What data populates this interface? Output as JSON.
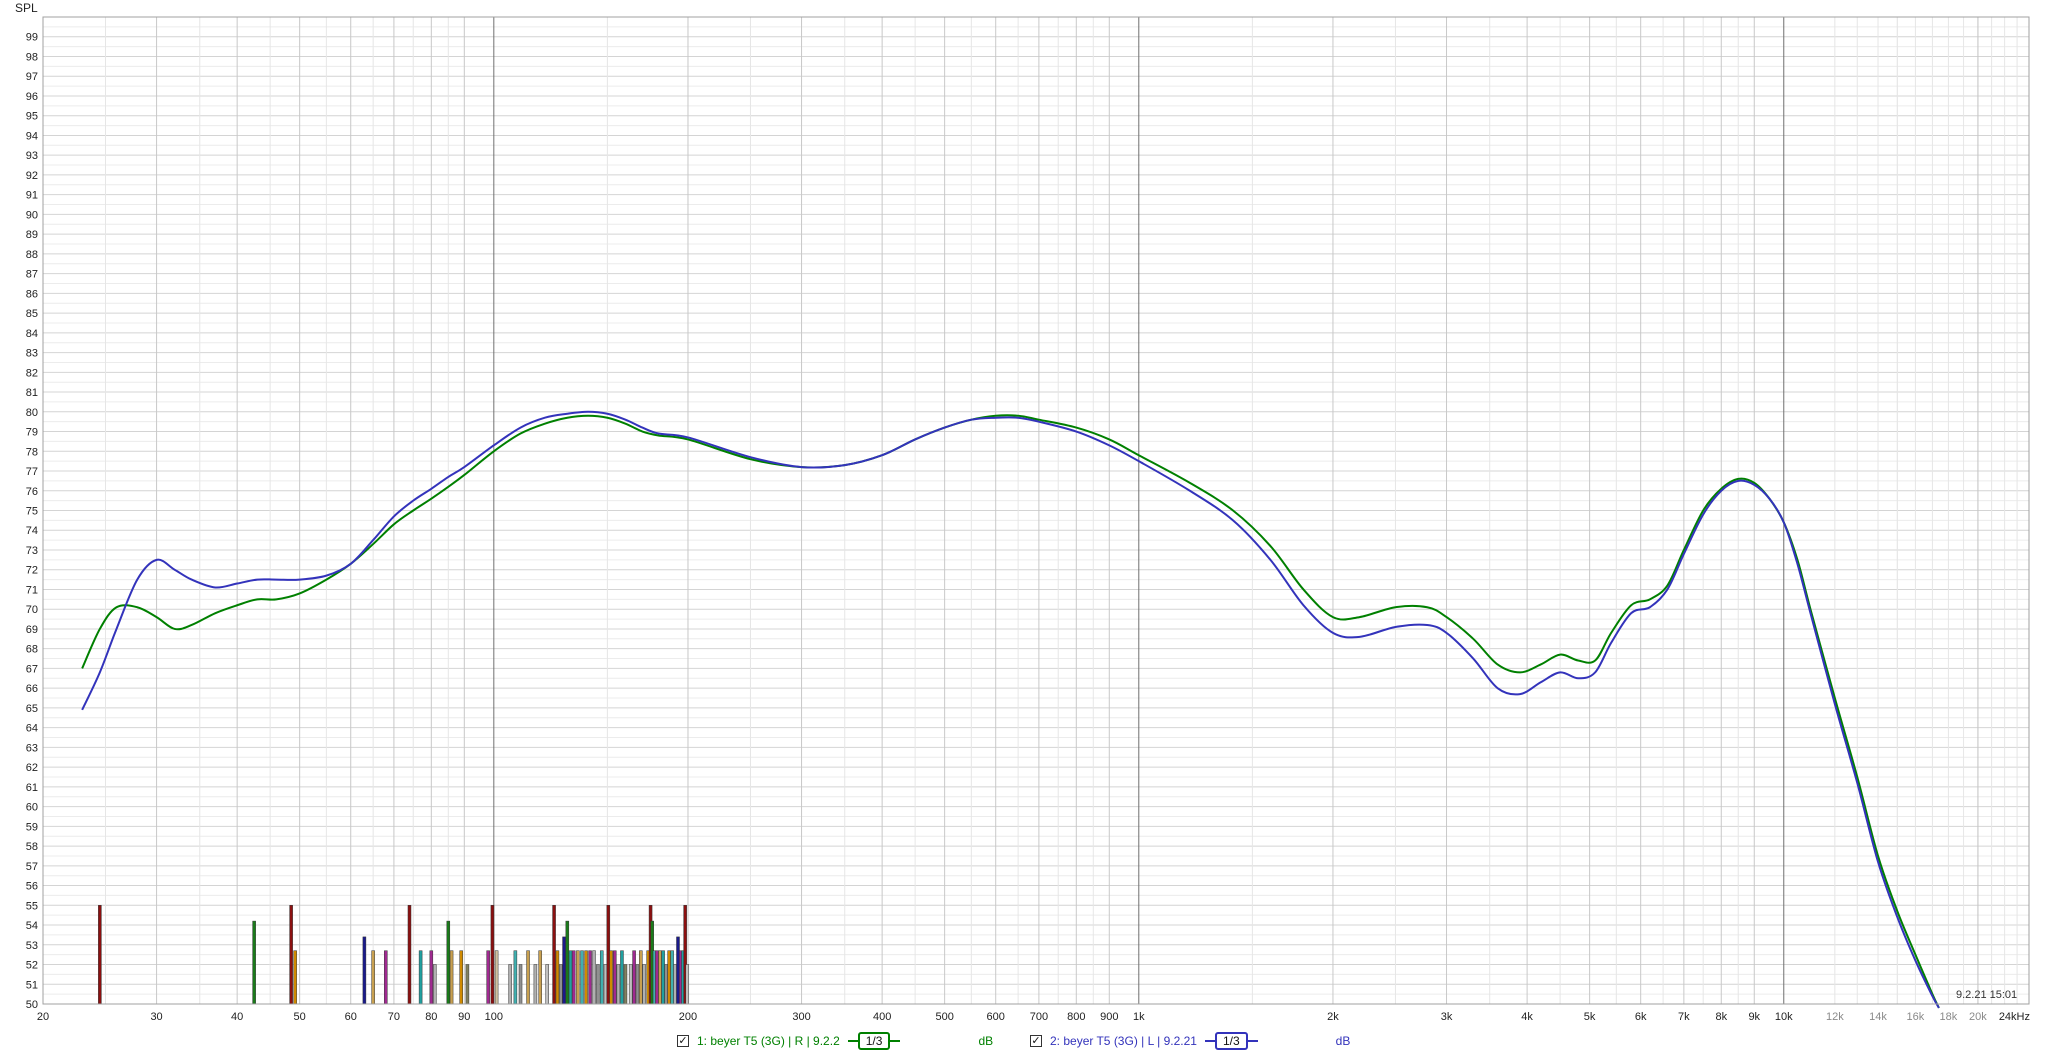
{
  "chart_data": {
    "type": "line",
    "title": "",
    "ylabel": "SPL",
    "xlabel": "",
    "x_scale": "log",
    "xlim": [
      20,
      24000
    ],
    "ylim": [
      50,
      100
    ],
    "grid": true,
    "timestamp": "9.2.21 15:01",
    "x_ticks": [
      {
        "v": 20,
        "label": "20"
      },
      {
        "v": 30,
        "label": "30"
      },
      {
        "v": 40,
        "label": "40"
      },
      {
        "v": 50,
        "label": "50"
      },
      {
        "v": 60,
        "label": "60"
      },
      {
        "v": 70,
        "label": "70"
      },
      {
        "v": 80,
        "label": "80"
      },
      {
        "v": 90,
        "label": "90"
      },
      {
        "v": 100,
        "label": "100"
      },
      {
        "v": 200,
        "label": "200"
      },
      {
        "v": 300,
        "label": "300"
      },
      {
        "v": 400,
        "label": "400"
      },
      {
        "v": 500,
        "label": "500"
      },
      {
        "v": 600,
        "label": "600"
      },
      {
        "v": 700,
        "label": "700"
      },
      {
        "v": 800,
        "label": "800"
      },
      {
        "v": 900,
        "label": "900"
      },
      {
        "v": 1000,
        "label": "1k"
      },
      {
        "v": 2000,
        "label": "2k"
      },
      {
        "v": 3000,
        "label": "3k"
      },
      {
        "v": 4000,
        "label": "4k"
      },
      {
        "v": 5000,
        "label": "5k"
      },
      {
        "v": 6000,
        "label": "6k"
      },
      {
        "v": 7000,
        "label": "7k"
      },
      {
        "v": 8000,
        "label": "8k"
      },
      {
        "v": 9000,
        "label": "9k"
      },
      {
        "v": 10000,
        "label": "10k"
      },
      {
        "v": 12000,
        "label": "12k"
      },
      {
        "v": 14000,
        "label": "14k"
      },
      {
        "v": 16000,
        "label": "16k"
      },
      {
        "v": 18000,
        "label": "18k"
      },
      {
        "v": 20000,
        "label": "20k"
      },
      {
        "v": 24000,
        "label": "24kHz"
      }
    ],
    "series": [
      {
        "name": "1: beyer T5 (3G) | R | 9.2.2",
        "color": "#008000",
        "points": [
          [
            23,
            67.0
          ],
          [
            24.5,
            69.0
          ],
          [
            26,
            70.1
          ],
          [
            28,
            70.1
          ],
          [
            30,
            69.6
          ],
          [
            32,
            69.0
          ],
          [
            34,
            69.2
          ],
          [
            37,
            69.8
          ],
          [
            40,
            70.2
          ],
          [
            43,
            70.5
          ],
          [
            46,
            70.5
          ],
          [
            50,
            70.8
          ],
          [
            55,
            71.5
          ],
          [
            60,
            72.3
          ],
          [
            65,
            73.3
          ],
          [
            70,
            74.3
          ],
          [
            75,
            75.0
          ],
          [
            80,
            75.6
          ],
          [
            85,
            76.2
          ],
          [
            90,
            76.8
          ],
          [
            100,
            78.0
          ],
          [
            110,
            78.9
          ],
          [
            120,
            79.4
          ],
          [
            130,
            79.7
          ],
          [
            140,
            79.8
          ],
          [
            150,
            79.7
          ],
          [
            160,
            79.4
          ],
          [
            170,
            79.0
          ],
          [
            180,
            78.8
          ],
          [
            200,
            78.6
          ],
          [
            250,
            77.6
          ],
          [
            300,
            77.2
          ],
          [
            350,
            77.3
          ],
          [
            400,
            77.8
          ],
          [
            450,
            78.6
          ],
          [
            500,
            79.2
          ],
          [
            550,
            79.6
          ],
          [
            600,
            79.8
          ],
          [
            650,
            79.8
          ],
          [
            700,
            79.6
          ],
          [
            800,
            79.2
          ],
          [
            900,
            78.6
          ],
          [
            1000,
            77.8
          ],
          [
            1200,
            76.4
          ],
          [
            1400,
            75.0
          ],
          [
            1600,
            73.2
          ],
          [
            1800,
            71.0
          ],
          [
            2000,
            69.6
          ],
          [
            2200,
            69.6
          ],
          [
            2500,
            70.1
          ],
          [
            2800,
            70.1
          ],
          [
            3000,
            69.6
          ],
          [
            3300,
            68.5
          ],
          [
            3600,
            67.2
          ],
          [
            3900,
            66.8
          ],
          [
            4200,
            67.2
          ],
          [
            4500,
            67.7
          ],
          [
            4800,
            67.4
          ],
          [
            5100,
            67.4
          ],
          [
            5400,
            68.8
          ],
          [
            5800,
            70.2
          ],
          [
            6200,
            70.5
          ],
          [
            6600,
            71.2
          ],
          [
            7000,
            73.0
          ],
          [
            7500,
            75.0
          ],
          [
            8000,
            76.1
          ],
          [
            8500,
            76.6
          ],
          [
            9000,
            76.4
          ],
          [
            9500,
            75.6
          ],
          [
            10000,
            74.4
          ],
          [
            10500,
            72.5
          ],
          [
            11000,
            70.0
          ],
          [
            12000,
            65.5
          ],
          [
            13000,
            61.5
          ],
          [
            14000,
            57.5
          ],
          [
            15000,
            54.7
          ],
          [
            16000,
            52.5
          ],
          [
            17000,
            50.5
          ],
          [
            17400,
            49.8
          ]
        ]
      },
      {
        "name": "2: beyer T5 (3G) | L | 9.2.21",
        "color": "#3333bb",
        "points": [
          [
            23,
            64.9
          ],
          [
            24.5,
            66.8
          ],
          [
            26,
            69.0
          ],
          [
            28,
            71.5
          ],
          [
            30,
            72.5
          ],
          [
            32,
            72.0
          ],
          [
            34,
            71.5
          ],
          [
            37,
            71.1
          ],
          [
            40,
            71.3
          ],
          [
            43,
            71.5
          ],
          [
            46,
            71.5
          ],
          [
            50,
            71.5
          ],
          [
            55,
            71.7
          ],
          [
            60,
            72.3
          ],
          [
            65,
            73.5
          ],
          [
            70,
            74.7
          ],
          [
            75,
            75.5
          ],
          [
            80,
            76.1
          ],
          [
            85,
            76.7
          ],
          [
            90,
            77.2
          ],
          [
            100,
            78.3
          ],
          [
            110,
            79.2
          ],
          [
            120,
            79.7
          ],
          [
            130,
            79.9
          ],
          [
            140,
            80.0
          ],
          [
            150,
            79.9
          ],
          [
            160,
            79.6
          ],
          [
            170,
            79.2
          ],
          [
            180,
            78.9
          ],
          [
            200,
            78.7
          ],
          [
            250,
            77.7
          ],
          [
            300,
            77.2
          ],
          [
            350,
            77.3
          ],
          [
            400,
            77.8
          ],
          [
            450,
            78.6
          ],
          [
            500,
            79.2
          ],
          [
            550,
            79.6
          ],
          [
            600,
            79.7
          ],
          [
            650,
            79.7
          ],
          [
            700,
            79.5
          ],
          [
            800,
            79.0
          ],
          [
            900,
            78.3
          ],
          [
            1000,
            77.5
          ],
          [
            1200,
            76.0
          ],
          [
            1400,
            74.5
          ],
          [
            1600,
            72.5
          ],
          [
            1800,
            70.2
          ],
          [
            2000,
            68.8
          ],
          [
            2200,
            68.6
          ],
          [
            2500,
            69.1
          ],
          [
            2800,
            69.2
          ],
          [
            3000,
            68.8
          ],
          [
            3300,
            67.5
          ],
          [
            3600,
            66.0
          ],
          [
            3900,
            65.7
          ],
          [
            4200,
            66.3
          ],
          [
            4500,
            66.8
          ],
          [
            4800,
            66.5
          ],
          [
            5100,
            66.8
          ],
          [
            5400,
            68.3
          ],
          [
            5800,
            69.8
          ],
          [
            6200,
            70.1
          ],
          [
            6600,
            71.0
          ],
          [
            7000,
            72.8
          ],
          [
            7500,
            74.8
          ],
          [
            8000,
            76.0
          ],
          [
            8500,
            76.5
          ],
          [
            9000,
            76.3
          ],
          [
            9500,
            75.6
          ],
          [
            10000,
            74.4
          ],
          [
            10500,
            72.3
          ],
          [
            11000,
            69.8
          ],
          [
            12000,
            65.2
          ],
          [
            13000,
            61.2
          ],
          [
            14000,
            57.2
          ],
          [
            15000,
            54.4
          ],
          [
            16000,
            52.2
          ],
          [
            17000,
            50.4
          ],
          [
            17400,
            49.8
          ]
        ]
      }
    ],
    "distortion_bars": [
      {
        "x": 24.5,
        "y": 55.0,
        "color": "#8b1010"
      },
      {
        "x": 42.5,
        "y": 54.2,
        "color": "#1a7a1a"
      },
      {
        "x": 48.5,
        "y": 55.0,
        "color": "#8b1010"
      },
      {
        "x": 49.2,
        "y": 52.7,
        "color": "#d08a00"
      },
      {
        "x": 63,
        "y": 53.4,
        "color": "#1a1a8b"
      },
      {
        "x": 65,
        "y": 52.7,
        "color": "#c8a050"
      },
      {
        "x": 68,
        "y": 52.7,
        "color": "#a02a90"
      },
      {
        "x": 74,
        "y": 55.0,
        "color": "#8b1010"
      },
      {
        "x": 77,
        "y": 52.7,
        "color": "#20a0a0"
      },
      {
        "x": 80,
        "y": 52.7,
        "color": "#a02a90"
      },
      {
        "x": 81,
        "y": 52.0,
        "color": "#b0b0b0"
      },
      {
        "x": 85,
        "y": 54.2,
        "color": "#1a7a1a"
      },
      {
        "x": 86,
        "y": 52.7,
        "color": "#c8a050"
      },
      {
        "x": 89,
        "y": 52.7,
        "color": "#d08a00"
      },
      {
        "x": 91,
        "y": 52.0,
        "color": "#808060"
      },
      {
        "x": 98,
        "y": 52.7,
        "color": "#a02a90"
      },
      {
        "x": 99.5,
        "y": 55.0,
        "color": "#8b1010"
      },
      {
        "x": 101,
        "y": 52.7,
        "color": "#d0c0a0"
      },
      {
        "x": 106,
        "y": 52.0,
        "color": "#b0b0b0"
      },
      {
        "x": 108,
        "y": 52.7,
        "color": "#40b0b0"
      },
      {
        "x": 110,
        "y": 52.0,
        "color": "#909090"
      },
      {
        "x": 113,
        "y": 52.7,
        "color": "#c8a050"
      },
      {
        "x": 116,
        "y": 52.0,
        "color": "#b0b0b0"
      },
      {
        "x": 118,
        "y": 52.7,
        "color": "#c8a050"
      },
      {
        "x": 121,
        "y": 52.0,
        "color": "#c0c0c0"
      },
      {
        "x": 124,
        "y": 55.0,
        "color": "#8b1010"
      },
      {
        "x": 125.5,
        "y": 52.7,
        "color": "#d08a00"
      },
      {
        "x": 127,
        "y": 52.0,
        "color": "#909090"
      },
      {
        "x": 128.5,
        "y": 53.4,
        "color": "#1a1a8b"
      },
      {
        "x": 130,
        "y": 54.2,
        "color": "#1a7a1a"
      },
      {
        "x": 131.5,
        "y": 52.7,
        "color": "#20a0a0"
      },
      {
        "x": 133,
        "y": 52.7,
        "color": "#a02a90"
      },
      {
        "x": 135,
        "y": 52.7,
        "color": "#c8a050"
      },
      {
        "x": 137,
        "y": 52.7,
        "color": "#40b0b0"
      },
      {
        "x": 139,
        "y": 52.7,
        "color": "#d08a00"
      },
      {
        "x": 141,
        "y": 52.7,
        "color": "#a02a90"
      },
      {
        "x": 143,
        "y": 52.7,
        "color": "#b0b0b0"
      },
      {
        "x": 145,
        "y": 52.0,
        "color": "#909090"
      },
      {
        "x": 147,
        "y": 52.7,
        "color": "#40b0b0"
      },
      {
        "x": 149,
        "y": 52.0,
        "color": "#c0c0c0"
      },
      {
        "x": 150.5,
        "y": 55.0,
        "color": "#8b1010"
      },
      {
        "x": 152,
        "y": 52.7,
        "color": "#d08a00"
      },
      {
        "x": 154,
        "y": 52.7,
        "color": "#a02a90"
      },
      {
        "x": 156,
        "y": 52.0,
        "color": "#b0b0b0"
      },
      {
        "x": 158,
        "y": 52.7,
        "color": "#20a0a0"
      },
      {
        "x": 160,
        "y": 52.0,
        "color": "#808060"
      },
      {
        "x": 163,
        "y": 52.0,
        "color": "#c0c0c0"
      },
      {
        "x": 165,
        "y": 52.7,
        "color": "#a02a90"
      },
      {
        "x": 167,
        "y": 52.0,
        "color": "#909090"
      },
      {
        "x": 169,
        "y": 52.7,
        "color": "#c8a050"
      },
      {
        "x": 171,
        "y": 52.0,
        "color": "#b0b0b0"
      },
      {
        "x": 173.5,
        "y": 52.7,
        "color": "#d08a00"
      },
      {
        "x": 175,
        "y": 55.0,
        "color": "#8b1010"
      },
      {
        "x": 176,
        "y": 54.2,
        "color": "#1a7a1a"
      },
      {
        "x": 177.5,
        "y": 52.7,
        "color": "#40b0b0"
      },
      {
        "x": 179,
        "y": 52.7,
        "color": "#a02a90"
      },
      {
        "x": 181,
        "y": 52.7,
        "color": "#c8a050"
      },
      {
        "x": 183,
        "y": 52.7,
        "color": "#20a0a0"
      },
      {
        "x": 185,
        "y": 52.0,
        "color": "#909090"
      },
      {
        "x": 187,
        "y": 52.7,
        "color": "#d08a00"
      },
      {
        "x": 189,
        "y": 52.7,
        "color": "#40b0b0"
      },
      {
        "x": 191,
        "y": 52.0,
        "color": "#b0b0b0"
      },
      {
        "x": 193,
        "y": 53.4,
        "color": "#1a1a8b"
      },
      {
        "x": 195,
        "y": 52.7,
        "color": "#a02a90"
      },
      {
        "x": 196.5,
        "y": 52.7,
        "color": "#20a0a0"
      },
      {
        "x": 198,
        "y": 55.0,
        "color": "#8b1010"
      },
      {
        "x": 199.5,
        "y": 52.0,
        "color": "#c0c0c0"
      }
    ]
  },
  "legend": {
    "items": [
      {
        "label": "1: beyer T5 (3G) | R | 9.2.2",
        "smoothing": "1/3",
        "unit": "dB",
        "color": "#008000"
      },
      {
        "label": "2: beyer T5 (3G) | L | 9.2.21",
        "smoothing": "1/3",
        "unit": "dB",
        "color": "#3333bb"
      }
    ]
  }
}
